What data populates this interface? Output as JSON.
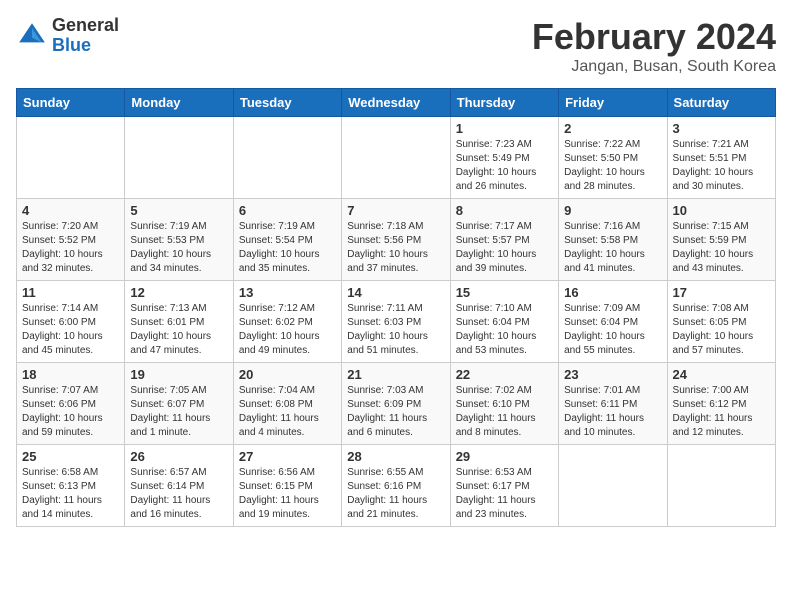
{
  "header": {
    "logo_general": "General",
    "logo_blue": "Blue",
    "month_title": "February 2024",
    "location": "Jangan, Busan, South Korea"
  },
  "weekdays": [
    "Sunday",
    "Monday",
    "Tuesday",
    "Wednesday",
    "Thursday",
    "Friday",
    "Saturday"
  ],
  "weeks": [
    [
      {
        "day": "",
        "info": ""
      },
      {
        "day": "",
        "info": ""
      },
      {
        "day": "",
        "info": ""
      },
      {
        "day": "",
        "info": ""
      },
      {
        "day": "1",
        "info": "Sunrise: 7:23 AM\nSunset: 5:49 PM\nDaylight: 10 hours\nand 26 minutes."
      },
      {
        "day": "2",
        "info": "Sunrise: 7:22 AM\nSunset: 5:50 PM\nDaylight: 10 hours\nand 28 minutes."
      },
      {
        "day": "3",
        "info": "Sunrise: 7:21 AM\nSunset: 5:51 PM\nDaylight: 10 hours\nand 30 minutes."
      }
    ],
    [
      {
        "day": "4",
        "info": "Sunrise: 7:20 AM\nSunset: 5:52 PM\nDaylight: 10 hours\nand 32 minutes."
      },
      {
        "day": "5",
        "info": "Sunrise: 7:19 AM\nSunset: 5:53 PM\nDaylight: 10 hours\nand 34 minutes."
      },
      {
        "day": "6",
        "info": "Sunrise: 7:19 AM\nSunset: 5:54 PM\nDaylight: 10 hours\nand 35 minutes."
      },
      {
        "day": "7",
        "info": "Sunrise: 7:18 AM\nSunset: 5:56 PM\nDaylight: 10 hours\nand 37 minutes."
      },
      {
        "day": "8",
        "info": "Sunrise: 7:17 AM\nSunset: 5:57 PM\nDaylight: 10 hours\nand 39 minutes."
      },
      {
        "day": "9",
        "info": "Sunrise: 7:16 AM\nSunset: 5:58 PM\nDaylight: 10 hours\nand 41 minutes."
      },
      {
        "day": "10",
        "info": "Sunrise: 7:15 AM\nSunset: 5:59 PM\nDaylight: 10 hours\nand 43 minutes."
      }
    ],
    [
      {
        "day": "11",
        "info": "Sunrise: 7:14 AM\nSunset: 6:00 PM\nDaylight: 10 hours\nand 45 minutes."
      },
      {
        "day": "12",
        "info": "Sunrise: 7:13 AM\nSunset: 6:01 PM\nDaylight: 10 hours\nand 47 minutes."
      },
      {
        "day": "13",
        "info": "Sunrise: 7:12 AM\nSunset: 6:02 PM\nDaylight: 10 hours\nand 49 minutes."
      },
      {
        "day": "14",
        "info": "Sunrise: 7:11 AM\nSunset: 6:03 PM\nDaylight: 10 hours\nand 51 minutes."
      },
      {
        "day": "15",
        "info": "Sunrise: 7:10 AM\nSunset: 6:04 PM\nDaylight: 10 hours\nand 53 minutes."
      },
      {
        "day": "16",
        "info": "Sunrise: 7:09 AM\nSunset: 6:04 PM\nDaylight: 10 hours\nand 55 minutes."
      },
      {
        "day": "17",
        "info": "Sunrise: 7:08 AM\nSunset: 6:05 PM\nDaylight: 10 hours\nand 57 minutes."
      }
    ],
    [
      {
        "day": "18",
        "info": "Sunrise: 7:07 AM\nSunset: 6:06 PM\nDaylight: 10 hours\nand 59 minutes."
      },
      {
        "day": "19",
        "info": "Sunrise: 7:05 AM\nSunset: 6:07 PM\nDaylight: 11 hours\nand 1 minute."
      },
      {
        "day": "20",
        "info": "Sunrise: 7:04 AM\nSunset: 6:08 PM\nDaylight: 11 hours\nand 4 minutes."
      },
      {
        "day": "21",
        "info": "Sunrise: 7:03 AM\nSunset: 6:09 PM\nDaylight: 11 hours\nand 6 minutes."
      },
      {
        "day": "22",
        "info": "Sunrise: 7:02 AM\nSunset: 6:10 PM\nDaylight: 11 hours\nand 8 minutes."
      },
      {
        "day": "23",
        "info": "Sunrise: 7:01 AM\nSunset: 6:11 PM\nDaylight: 11 hours\nand 10 minutes."
      },
      {
        "day": "24",
        "info": "Sunrise: 7:00 AM\nSunset: 6:12 PM\nDaylight: 11 hours\nand 12 minutes."
      }
    ],
    [
      {
        "day": "25",
        "info": "Sunrise: 6:58 AM\nSunset: 6:13 PM\nDaylight: 11 hours\nand 14 minutes."
      },
      {
        "day": "26",
        "info": "Sunrise: 6:57 AM\nSunset: 6:14 PM\nDaylight: 11 hours\nand 16 minutes."
      },
      {
        "day": "27",
        "info": "Sunrise: 6:56 AM\nSunset: 6:15 PM\nDaylight: 11 hours\nand 19 minutes."
      },
      {
        "day": "28",
        "info": "Sunrise: 6:55 AM\nSunset: 6:16 PM\nDaylight: 11 hours\nand 21 minutes."
      },
      {
        "day": "29",
        "info": "Sunrise: 6:53 AM\nSunset: 6:17 PM\nDaylight: 11 hours\nand 23 minutes."
      },
      {
        "day": "",
        "info": ""
      },
      {
        "day": "",
        "info": ""
      }
    ]
  ]
}
